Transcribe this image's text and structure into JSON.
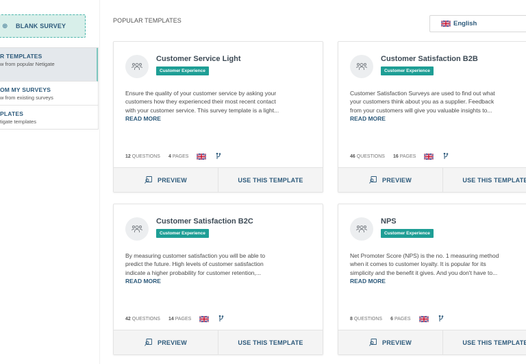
{
  "sidebar": {
    "blank_survey_label": "BLANK SURVEY",
    "items": [
      {
        "title": "R TEMPLATES",
        "subtitle": "w from popular Netigate",
        "active": true
      },
      {
        "title": "OM MY SURVEYS",
        "subtitle": "w from existing surveys",
        "active": false
      },
      {
        "title": "PLATES",
        "subtitle": "tigate templates",
        "active": false
      }
    ]
  },
  "header": {
    "section_title": "POPULAR TEMPLATES",
    "language": {
      "icon": "uk-flag-icon",
      "selected": "English"
    }
  },
  "cards": [
    {
      "title": "Customer Service Light",
      "tag": "Customer Experience",
      "description_lines": [
        "Ensure the quality of your customer service by asking your",
        "customers how they experienced their most recent contact",
        "with your customer service. This survey template is a light..."
      ],
      "read_more": "READ MORE",
      "questions_count": "12",
      "questions_label": "QUESTIONS",
      "pages_count": "4",
      "pages_label": "PAGES",
      "preview_label": "PREVIEW",
      "use_label": "USE THIS TEMPLATE"
    },
    {
      "title": "Customer Satisfaction B2B",
      "tag": "Customer Experience",
      "description_lines": [
        "Customer Satisfaction Surveys are used to find out what",
        "your customers think about you as a supplier. Feedback",
        "from your customers will give you valuable insights to..."
      ],
      "read_more": "READ MORE",
      "questions_count": "46",
      "questions_label": "QUESTIONS",
      "pages_count": "16",
      "pages_label": "PAGES",
      "preview_label": "PREVIEW",
      "use_label": "USE THIS TEMPLATE"
    },
    {
      "title": "Customer Satisfaction B2C",
      "tag": "Customer Experience",
      "description_lines": [
        "By measuring customer satisfaction you will be able to",
        "predict the future. High levels of customer satisfaction",
        "indicate a higher probability for customer retention,..."
      ],
      "read_more": "READ MORE",
      "questions_count": "42",
      "questions_label": "QUESTIONS",
      "pages_count": "14",
      "pages_label": "PAGES",
      "preview_label": "PREVIEW",
      "use_label": "USE THIS TEMPLATE"
    },
    {
      "title": "NPS",
      "tag": "Customer Experience",
      "description_lines": [
        "Net Promoter Score (NPS) is the no. 1 measuring method",
        "when it comes to customer loyalty. It is popular for its",
        "simplicity and the benefit it gives. And you don't have to..."
      ],
      "read_more": "READ MORE",
      "questions_count": "8",
      "questions_label": "QUESTIONS",
      "pages_count": "6",
      "pages_label": "PAGES",
      "preview_label": "PREVIEW",
      "use_label": "USE THIS TEMPLATE"
    }
  ],
  "colors": {
    "accent_teal": "#1e9e95",
    "link_blue": "#2d5a7b",
    "blank_bg": "#d8efea"
  }
}
